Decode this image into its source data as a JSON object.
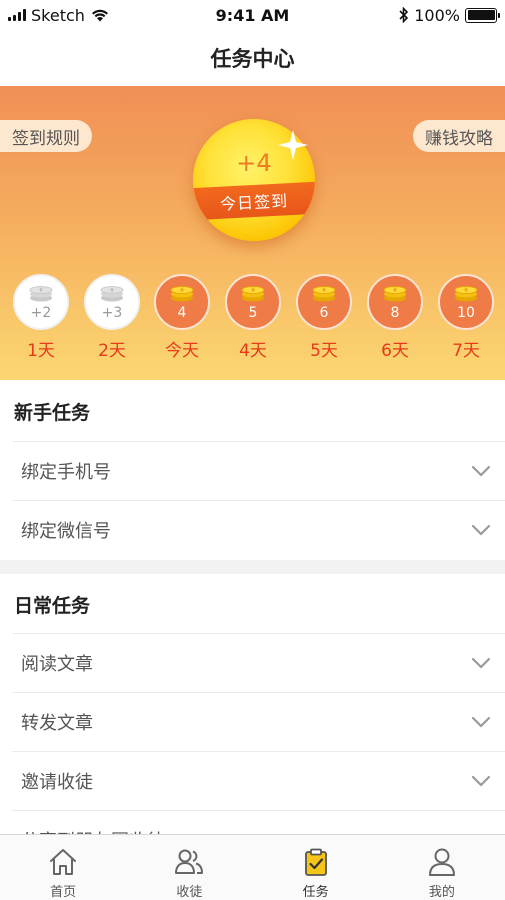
{
  "status_bar": {
    "carrier": "Sketch",
    "time": "9:41 AM",
    "battery": "100%"
  },
  "nav": {
    "title": "任务中心"
  },
  "hero": {
    "rules_label": "签到规则",
    "guide_label": "赚钱攻略",
    "today_bonus": "+4",
    "checkin_label": "今日签到",
    "days": [
      {
        "value": "+2",
        "label": "1天",
        "state": "done"
      },
      {
        "value": "+3",
        "label": "2天",
        "state": "done"
      },
      {
        "value": "4",
        "label": "今天",
        "state": "todo"
      },
      {
        "value": "5",
        "label": "4天",
        "state": "todo"
      },
      {
        "value": "6",
        "label": "5天",
        "state": "todo"
      },
      {
        "value": "8",
        "label": "6天",
        "state": "todo"
      },
      {
        "value": "10",
        "label": "7天",
        "state": "todo"
      }
    ]
  },
  "newbie": {
    "title": "新手任务",
    "tasks": [
      {
        "label": "绑定手机号"
      },
      {
        "label": "绑定微信号"
      }
    ]
  },
  "daily": {
    "title": "日常任务",
    "tasks": [
      {
        "label": "阅读文章"
      },
      {
        "label": "转发文章"
      },
      {
        "label": "邀请收徒"
      },
      {
        "label": "分享到朋友圈收徒"
      }
    ]
  },
  "tabs": [
    {
      "label": "首页",
      "icon": "home-icon"
    },
    {
      "label": "收徒",
      "icon": "users-icon"
    },
    {
      "label": "任务",
      "icon": "clipboard-check-icon",
      "active": true
    },
    {
      "label": "我的",
      "icon": "user-icon"
    }
  ],
  "colors": {
    "accent": "#ef7b46",
    "day_label": "#e63a1a",
    "tab_active": "#f5c518"
  }
}
